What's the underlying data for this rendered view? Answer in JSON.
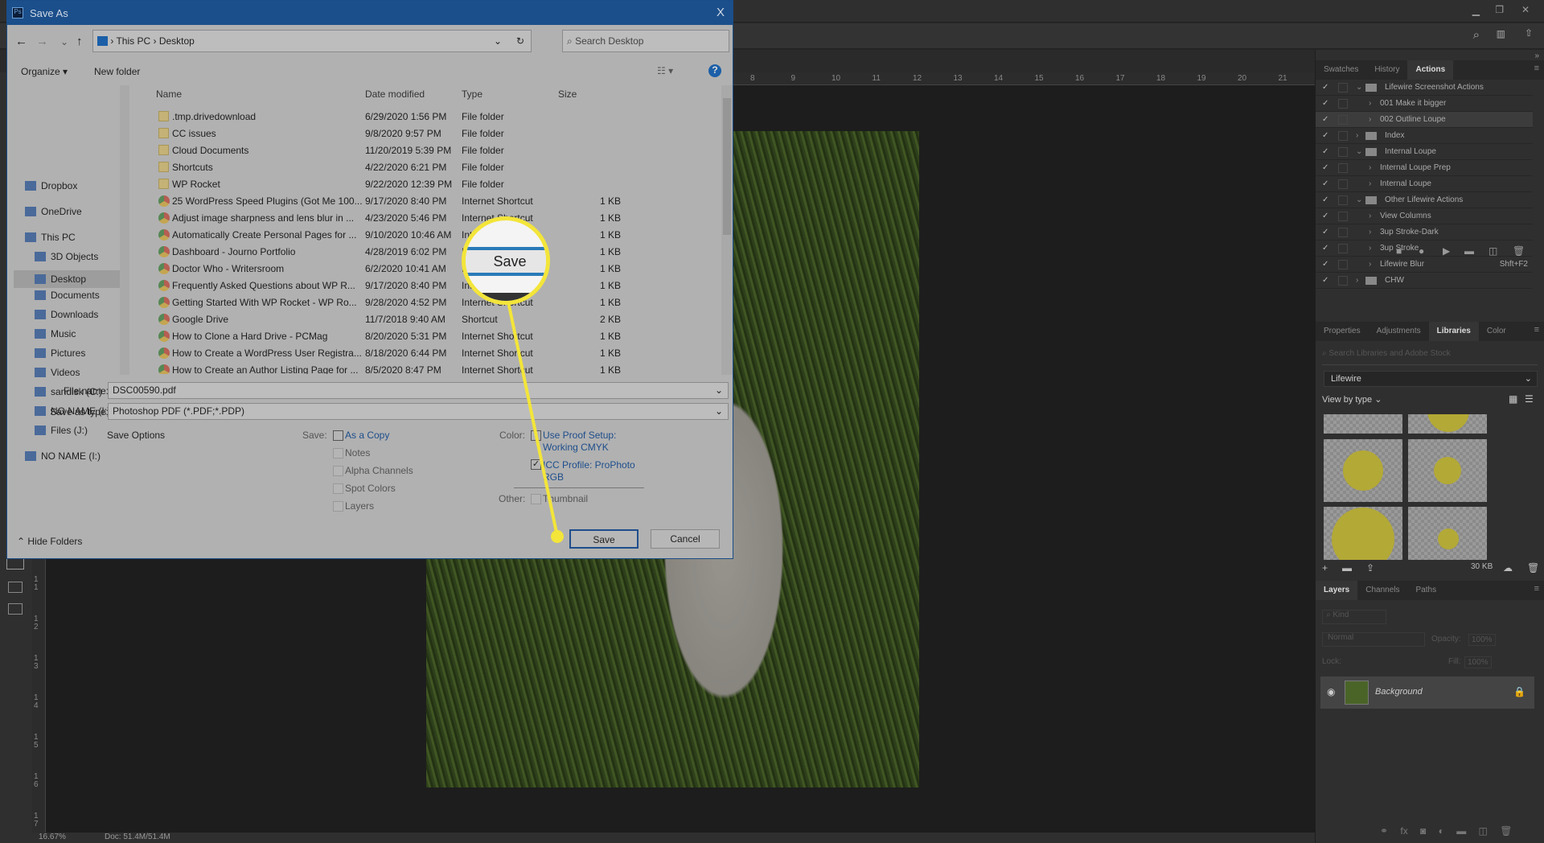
{
  "photoshop": {
    "ruler_h": [
      "8",
      "9",
      "10",
      "11",
      "12",
      "13",
      "14",
      "15",
      "16",
      "17",
      "18",
      "19",
      "20",
      "21"
    ],
    "ruler_v": [
      "11",
      "12",
      "13",
      "14",
      "15",
      "16",
      "17"
    ],
    "zoom": "16.67%",
    "doc": "Doc: 51.4M/51.4M",
    "actions_panel": {
      "tabs": [
        "Swatches",
        "History",
        "Actions"
      ],
      "active": "Actions",
      "items": [
        {
          "label": "Lifewire Screenshot Actions",
          "type": "set",
          "open": true
        },
        {
          "label": "001 Make it bigger",
          "type": "action"
        },
        {
          "label": "002 Outline Loupe",
          "type": "action",
          "selected": true
        },
        {
          "label": "Index",
          "type": "set",
          "open": false
        },
        {
          "label": "Internal Loupe",
          "type": "set",
          "open": true
        },
        {
          "label": "Internal Loupe Prep",
          "type": "action"
        },
        {
          "label": "Internal Loupe",
          "type": "action"
        },
        {
          "label": "Other Lifewire Actions",
          "type": "set",
          "open": true
        },
        {
          "label": "View Columns",
          "type": "action"
        },
        {
          "label": "3up Stroke-Dark",
          "type": "action"
        },
        {
          "label": "3up Stroke",
          "type": "action"
        },
        {
          "label": "Lifewire Blur",
          "type": "action",
          "shortcut": "Shft+F2"
        },
        {
          "label": "CHW",
          "type": "set",
          "open": false
        }
      ]
    },
    "libraries_panel": {
      "tabs": [
        "Properties",
        "Adjustments",
        "Libraries",
        "Color"
      ],
      "active": "Libraries",
      "search_placeholder": "Search Libraries and Adobe Stock",
      "library": "Lifewire",
      "view_by": "View by type",
      "size": "30 KB",
      "thumb_color": "#b3a936"
    },
    "layers_panel": {
      "tabs": [
        "Layers",
        "Channels",
        "Paths"
      ],
      "active": "Layers",
      "kind": "Kind",
      "blend": "Normal",
      "opacity_label": "Opacity:",
      "opacity": "100%",
      "lock_label": "Lock:",
      "fill_label": "Fill:",
      "fill": "100%",
      "layer": "Background"
    }
  },
  "dialog": {
    "title": "Save As",
    "close": "X",
    "breadcrumb": [
      "This PC",
      "Desktop"
    ],
    "search_placeholder": "Search Desktop",
    "organize": "Organize",
    "new_folder": "New folder",
    "help": "?",
    "nav": [
      {
        "label": "Dropbox",
        "level": 0
      },
      {
        "label": "OneDrive",
        "level": 0
      },
      {
        "label": "This PC",
        "level": 0
      },
      {
        "label": "3D Objects",
        "level": 1
      },
      {
        "label": "Desktop",
        "level": 1,
        "selected": true
      },
      {
        "label": "Documents",
        "level": 1
      },
      {
        "label": "Downloads",
        "level": 1
      },
      {
        "label": "Music",
        "level": 1
      },
      {
        "label": "Pictures",
        "level": 1
      },
      {
        "label": "Videos",
        "level": 1
      },
      {
        "label": "sandisk (C:)",
        "level": 1
      },
      {
        "label": "NO NAME (I:)",
        "level": 1
      },
      {
        "label": "Files (J:)",
        "level": 1
      },
      {
        "label": "NO NAME (I:)",
        "level": 0
      }
    ],
    "columns": [
      "Name",
      "Date modified",
      "Type",
      "Size"
    ],
    "files": [
      {
        "name": ".tmp.drivedownload",
        "date": "6/29/2020 1:56 PM",
        "type": "File folder",
        "size": "",
        "icon": "folder"
      },
      {
        "name": "CC issues",
        "date": "9/8/2020 9:57 PM",
        "type": "File folder",
        "size": "",
        "icon": "folder"
      },
      {
        "name": "Cloud Documents",
        "date": "11/20/2019 5:39 PM",
        "type": "File folder",
        "size": "",
        "icon": "folder"
      },
      {
        "name": "Shortcuts",
        "date": "4/22/2020 6:21 PM",
        "type": "File folder",
        "size": "",
        "icon": "folder"
      },
      {
        "name": "WP Rocket",
        "date": "9/22/2020 12:39 PM",
        "type": "File folder",
        "size": "",
        "icon": "folder"
      },
      {
        "name": "25 WordPress Speed Plugins (Got Me 100...",
        "date": "9/17/2020 8:40 PM",
        "type": "Internet Shortcut",
        "size": "1 KB",
        "icon": "link"
      },
      {
        "name": "Adjust image sharpness and lens blur in ...",
        "date": "4/23/2020 5:46 PM",
        "type": "Internet Shortcut",
        "size": "1 KB",
        "icon": "link"
      },
      {
        "name": "Automatically Create Personal Pages for ...",
        "date": "9/10/2020 10:46 AM",
        "type": "Internet Shortcut",
        "size": "1 KB",
        "icon": "link"
      },
      {
        "name": "Dashboard - Journo Portfolio",
        "date": "4/28/2019 6:02 PM",
        "type": "Internet Shortcut",
        "size": "1 KB",
        "icon": "link"
      },
      {
        "name": "Doctor Who - Writersroom",
        "date": "6/2/2020 10:41 AM",
        "type": "Internet Shortcut",
        "size": "1 KB",
        "icon": "link"
      },
      {
        "name": "Frequently Asked Questions about WP R...",
        "date": "9/17/2020 8:40 PM",
        "type": "Internet Shortcut",
        "size": "1 KB",
        "icon": "link"
      },
      {
        "name": "Getting Started With WP Rocket - WP Ro...",
        "date": "9/28/2020 4:52 PM",
        "type": "Internet Shortcut",
        "size": "1 KB",
        "icon": "link"
      },
      {
        "name": "Google Drive",
        "date": "11/7/2018 9:40 AM",
        "type": "Shortcut",
        "size": "2 KB",
        "icon": "link"
      },
      {
        "name": "How to Clone a Hard Drive - PCMag",
        "date": "8/20/2020 5:31 PM",
        "type": "Internet Shortcut",
        "size": "1 KB",
        "icon": "link"
      },
      {
        "name": "How to Create a WordPress User Registra...",
        "date": "8/18/2020 6:44 PM",
        "type": "Internet Shortcut",
        "size": "1 KB",
        "icon": "link"
      },
      {
        "name": "How to Create an Author Listing Page for ...",
        "date": "8/5/2020 8:47 PM",
        "type": "Internet Shortcut",
        "size": "1 KB",
        "icon": "link"
      }
    ],
    "file_name_label": "File name:",
    "file_name": "DSC00590.pdf",
    "save_type_label": "Save as type:",
    "save_type": "Photoshop PDF (*.PDF;*.PDP)",
    "save_options": "Save Options",
    "save_label": "Save:",
    "save_checks": [
      {
        "label": "As a Copy",
        "checked": false,
        "enabled": true
      },
      {
        "label": "Notes",
        "checked": false,
        "enabled": false
      },
      {
        "label": "Alpha Channels",
        "checked": false,
        "enabled": false
      },
      {
        "label": "Spot Colors",
        "checked": false,
        "enabled": false
      },
      {
        "label": "Layers",
        "checked": false,
        "enabled": false
      }
    ],
    "color_label": "Color:",
    "proof": "Use Proof Setup:",
    "proof2": "Working CMYK",
    "proof_checked": false,
    "icc": "ICC Profile:  ProPhoto",
    "icc2": "RGB",
    "icc_checked": true,
    "other_label": "Other:",
    "thumbnail": "Thumbnail",
    "thumbnail_checked": false,
    "hide_folders": "Hide Folders",
    "save_button": "Save",
    "cancel_button": "Cancel",
    "loupe_text": "Save",
    "highlight_color": "#f3e53a"
  }
}
